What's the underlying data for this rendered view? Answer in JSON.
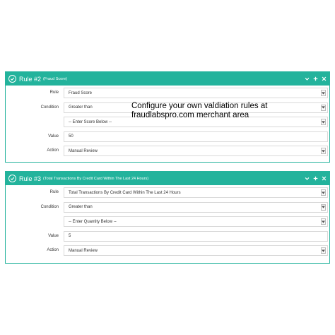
{
  "overlay": {
    "line1": "Configure your own valdiation rules at",
    "line2": "fraudlabspro.com merchant area"
  },
  "labels": {
    "rule": "Rule",
    "condition": "Condition",
    "value": "Value",
    "action": "Action"
  },
  "rules": [
    {
      "title": "Rule #2",
      "subtitle": "(Fraud Score)",
      "rule": "Fraud Score",
      "condition": "Greater than",
      "enter": "-- Enter Score Below --",
      "value": "50",
      "action": "Manual Review"
    },
    {
      "title": "Rule #3",
      "subtitle": "(Total Transactions By Credit Card Within The Last 24 Hours)",
      "rule": "Total Transactions By Credit Card Within The Last 24 Hours",
      "condition": "Greater than",
      "enter": "-- Enter Quantity Below --",
      "value": "5",
      "action": "Manual Review"
    }
  ],
  "colors": {
    "accent": "#23b39c",
    "border": "#d9d9d9"
  },
  "icons": [
    "check-circle-icon",
    "chevron-down-icon",
    "plus-icon",
    "close-icon",
    "select-caret-icon"
  ]
}
